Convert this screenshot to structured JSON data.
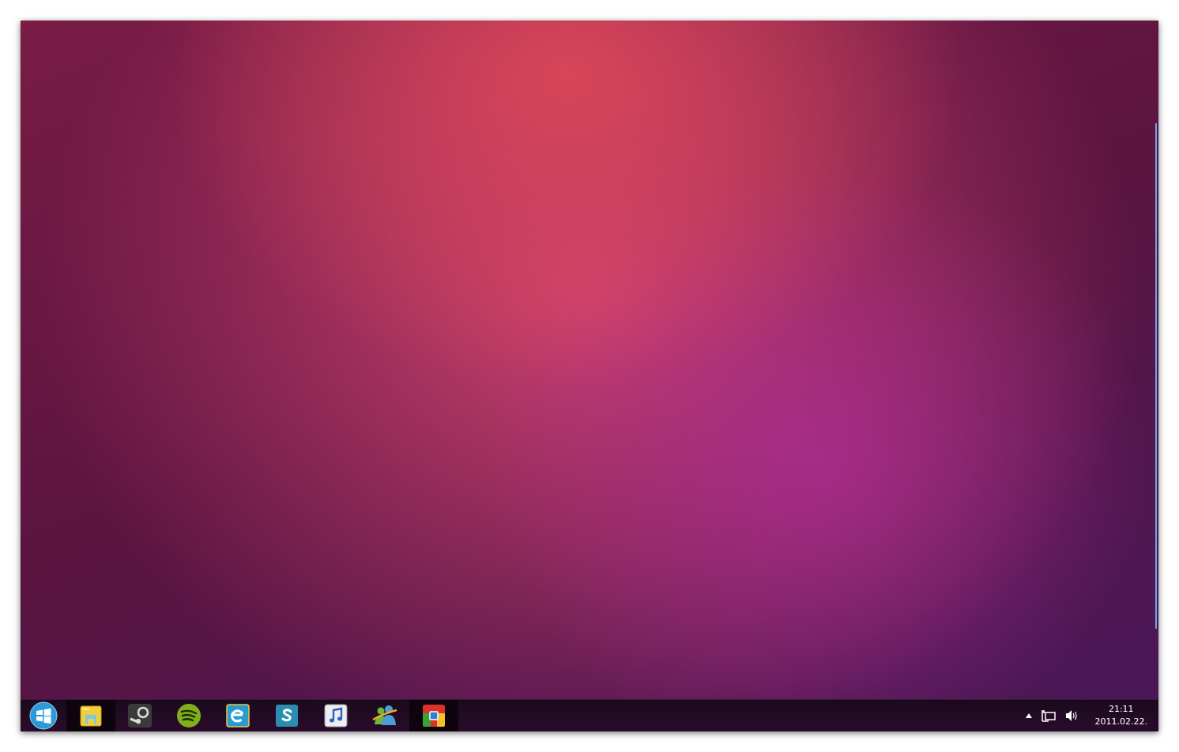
{
  "taskbar": {
    "apps": [
      {
        "kind": "folder",
        "running": true
      },
      {
        "kind": "steam",
        "running": false
      },
      {
        "kind": "spotify",
        "running": false
      },
      {
        "kind": "browser",
        "running": false
      },
      {
        "kind": "skype",
        "running": false
      },
      {
        "kind": "music",
        "running": false
      },
      {
        "kind": "messenger",
        "running": false
      },
      {
        "kind": "chrome",
        "running": true
      }
    ],
    "clock": {
      "time": "21:11",
      "date": "2011.02.22."
    }
  }
}
